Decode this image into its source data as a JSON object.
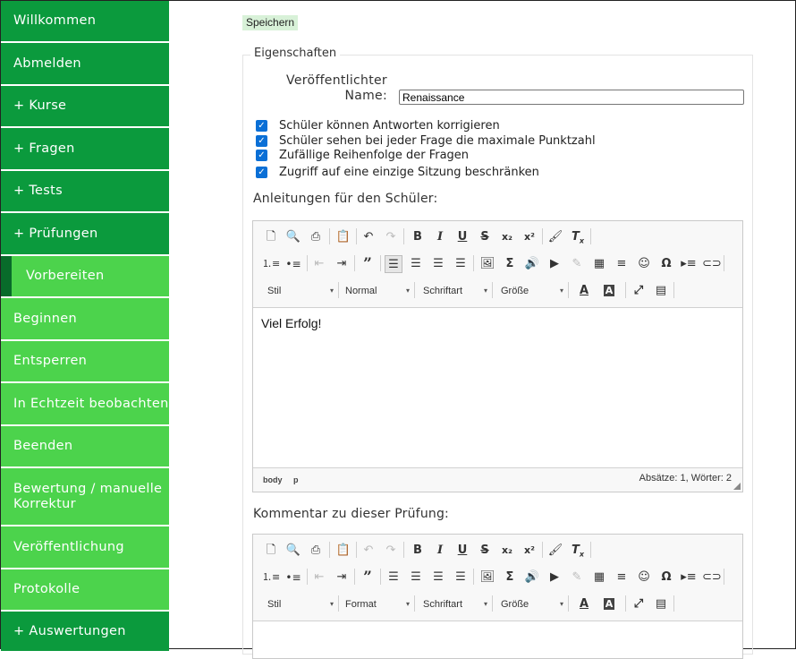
{
  "sidebar": {
    "items": [
      {
        "label": "Willkommen"
      },
      {
        "label": "Abmelden"
      },
      {
        "label": "+ Kurse"
      },
      {
        "label": "+ Fragen"
      },
      {
        "label": "+ Tests"
      },
      {
        "label": "+ Prüfungen"
      },
      {
        "label": "Vorbereiten"
      },
      {
        "label": "Beginnen"
      },
      {
        "label": "Entsperren"
      },
      {
        "label": "In Echtzeit beobachten"
      },
      {
        "label": "Beenden"
      },
      {
        "label": "Bewertung / manuelle Korrektur"
      },
      {
        "label": "Veröffentlichung"
      },
      {
        "label": "Protokolle"
      },
      {
        "label": "+ Auswertungen"
      }
    ],
    "colors": {
      "dark": "#0b9a3d",
      "light": "#4cd34c",
      "active_marker": "#086b2a"
    }
  },
  "toolbar": {
    "save_label": "Speichern"
  },
  "form": {
    "legend": "Eigenschaften",
    "name_label_1": "Veröffentlichter",
    "name_label_2": "Name:",
    "name_value": "Renaissance",
    "checkboxes": [
      {
        "label": "Schüler können Antworten korrigieren",
        "checked": true
      },
      {
        "label": "Schüler sehen bei jeder Frage die maximale Punktzahl",
        "checked": true
      },
      {
        "label": "Zufällige Reihenfolge der Fragen",
        "checked": true
      },
      {
        "label": "Zugriff auf eine einzige Sitzung beschränken",
        "checked": true
      }
    ],
    "instructions_label": "Anleitungen für den Schüler:",
    "comment_label": "Kommentar zu dieser Prüfung:"
  },
  "editor1": {
    "styles_combo": "Stil",
    "format_combo": "Normal",
    "font_combo": "Schriftart",
    "size_combo": "Größe",
    "content": "Viel Erfolg!",
    "path": [
      "body",
      "p"
    ],
    "wordcount": "Absätze: 1, Wörter: 2"
  },
  "editor2": {
    "styles_combo": "Stil",
    "format_combo": "Format",
    "font_combo": "Schriftart",
    "size_combo": "Größe"
  },
  "icons": {
    "new_page": "new-page-icon",
    "preview": "preview-icon",
    "print": "print-icon",
    "paste": "paste-icon",
    "undo": "undo-icon",
    "redo": "redo-icon",
    "bold": "B",
    "italic": "I",
    "underline": "U",
    "strike": "S",
    "subscript": "x₂",
    "superscript": "x²",
    "copy_format": "brush-icon",
    "remove_format": "Tx",
    "special_char": "Ω"
  }
}
